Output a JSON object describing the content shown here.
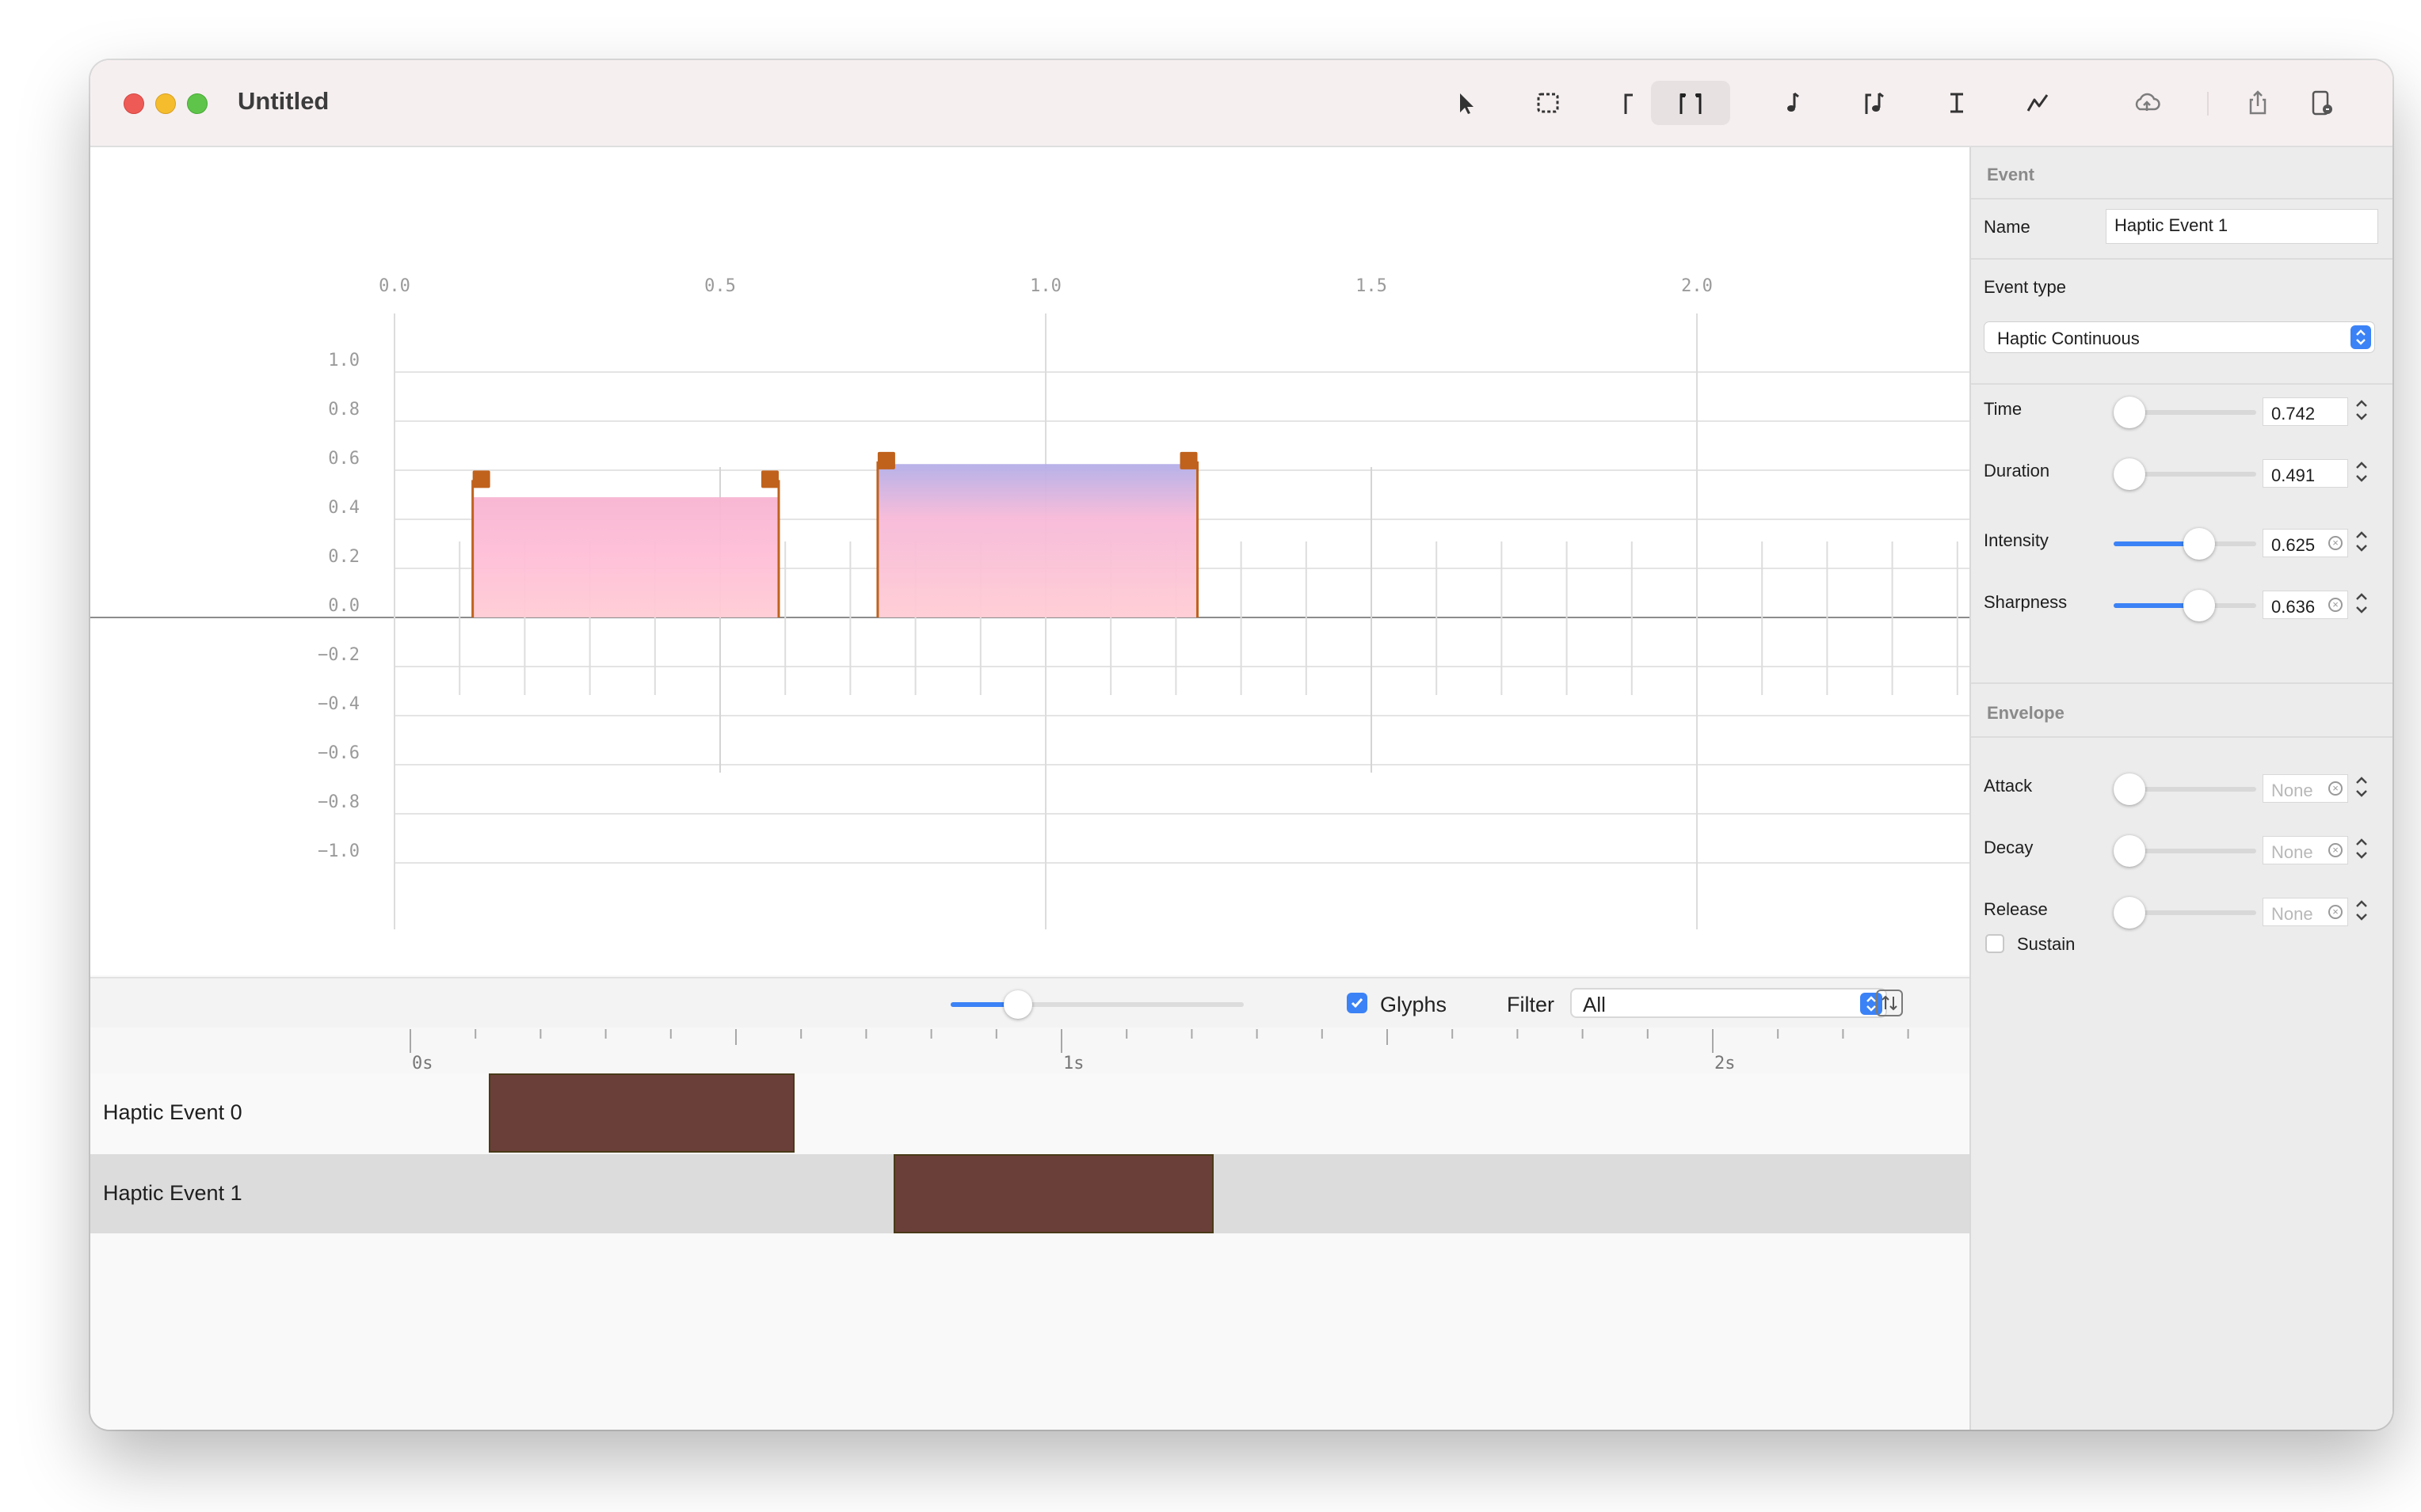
{
  "window": {
    "title": "Untitled"
  },
  "toolbar": {
    "tools": [
      {
        "name": "pointer-icon"
      },
      {
        "name": "marquee-select-icon"
      },
      {
        "name": "transient-event-icon"
      },
      {
        "name": "continuous-event-icon",
        "selected": true
      },
      {
        "name": "note-icon"
      },
      {
        "name": "audio-event-icon"
      },
      {
        "name": "text-cursor-icon"
      },
      {
        "name": "curve-icon"
      },
      {
        "name": "cloud-upload-icon"
      },
      {
        "name": "share-icon"
      },
      {
        "name": "device-icon"
      }
    ]
  },
  "editor": {
    "x_ticks": [
      "0.0",
      "0.5",
      "1.0",
      "1.5",
      "2.0"
    ],
    "y_ticks": [
      "1.0",
      "0.8",
      "0.6",
      "0.4",
      "0.2",
      "0.0",
      "−0.2",
      "−0.4",
      "−0.6",
      "−0.8",
      "−1.0"
    ]
  },
  "chart_data": {
    "type": "area",
    "title": "",
    "xlabel": "",
    "ylabel": "",
    "xlim": [
      0.0,
      2.4
    ],
    "ylim": [
      -1.0,
      1.0
    ],
    "series": [
      {
        "start": 0.12,
        "end": 0.59,
        "intensity": 0.49,
        "sharpness": 0.56
      },
      {
        "start": 0.742,
        "end": 1.233,
        "intensity": 0.625,
        "sharpness": 0.636
      }
    ]
  },
  "controls": {
    "zoom": 0.23,
    "glyphs_label": "Glyphs",
    "glyphs_checked": true,
    "filter_label": "Filter",
    "filter_value": "All"
  },
  "timeline": {
    "labels": [
      "0s",
      "1s",
      "2s"
    ],
    "tracks": [
      {
        "name": "Haptic Event 0",
        "start": 0.12,
        "duration": 0.47,
        "selected": false
      },
      {
        "name": "Haptic Event 1",
        "start": 0.742,
        "duration": 0.491,
        "selected": true
      }
    ]
  },
  "inspector": {
    "event_header": "Event",
    "name_label": "Name",
    "name_value": "Haptic Event 1",
    "event_type_label": "Event type",
    "event_type_value": "Haptic Continuous",
    "params": [
      {
        "label": "Time",
        "value": "0.742",
        "level": 0.0
      },
      {
        "label": "Duration",
        "value": "0.491",
        "level": 0.0
      },
      {
        "label": "Intensity",
        "value": "0.625",
        "level": 0.6
      },
      {
        "label": "Sharpness",
        "value": "0.636",
        "level": 0.6
      }
    ],
    "envelope_header": "Envelope",
    "envelope": [
      {
        "label": "Attack",
        "placeholder": "None"
      },
      {
        "label": "Decay",
        "placeholder": "None"
      },
      {
        "label": "Release",
        "placeholder": "None"
      }
    ],
    "sustain_label": "Sustain",
    "sustain_checked": false
  },
  "colors": {
    "accent": "#3b82f6",
    "handle": "#c0621c",
    "event_block": "#6b3f39",
    "fill_top_a": "#f7b4d2",
    "fill_top_b": "#b3aee8",
    "fill_bottom": "#ffccd4"
  }
}
